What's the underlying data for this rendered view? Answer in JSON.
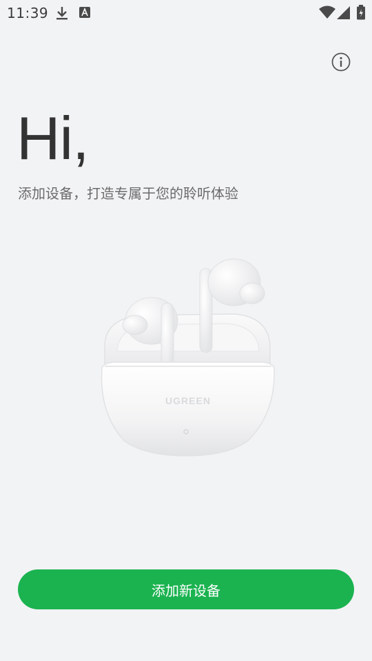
{
  "status_bar": {
    "time": "11:39",
    "icons": [
      "download-icon",
      "a-icon",
      "wifi-icon",
      "signal-icon",
      "battery-icon"
    ]
  },
  "header": {
    "info_icon": "info-icon"
  },
  "main": {
    "greeting": "Hi,",
    "subtitle": "添加设备，打造专属于您的聆听体验",
    "product_brand": "UGREEN"
  },
  "actions": {
    "add_device_label": "添加新设备"
  },
  "colors": {
    "background": "#f2f3f5",
    "accent": "#1bb350",
    "text_primary": "#333333",
    "text_secondary": "#6b6b6b"
  }
}
